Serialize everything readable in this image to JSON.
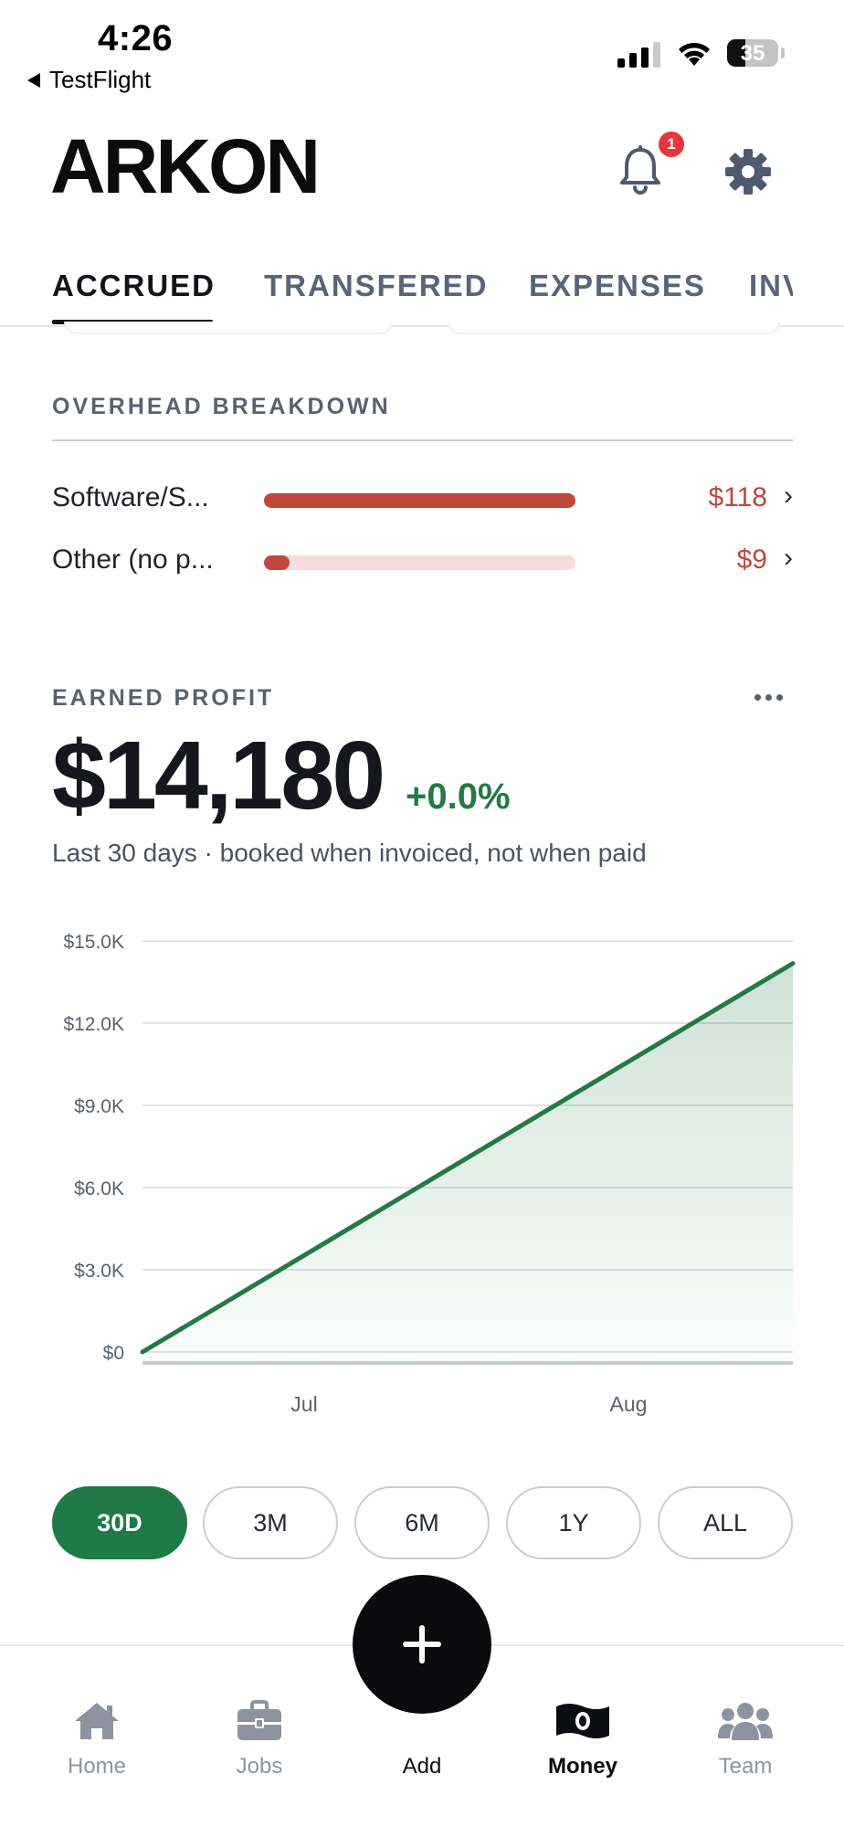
{
  "status_bar": {
    "time": "4:26",
    "back_app": "TestFlight",
    "battery_percent": "35"
  },
  "header": {
    "logo": "ARKON",
    "notification_count": "1",
    "icons": [
      "bell-icon",
      "gear-icon"
    ]
  },
  "tabs": [
    {
      "label": "ACCRUED",
      "active": true
    },
    {
      "label": "TRANSFERED",
      "active": false
    },
    {
      "label": "EXPENSES",
      "active": false
    },
    {
      "label": "INV",
      "active": false
    }
  ],
  "overhead": {
    "title": "OVERHEAD BREAKDOWN",
    "items": [
      {
        "name": "Software/S...",
        "value": "$118",
        "fill_fraction": 1.0
      },
      {
        "name": "Other (no p...",
        "value": "$9",
        "fill_fraction": 0.076
      }
    ]
  },
  "profit": {
    "title": "EARNED PROFIT",
    "amount": "$14,180",
    "change": "+0.0%",
    "subtitle": "Last 30 days · booked when invoiced, not when paid"
  },
  "chart_data": {
    "type": "area",
    "title": "",
    "xlabel": "",
    "ylabel": "",
    "x_tick_labels": [
      "Jul",
      "Aug"
    ],
    "y_tick_labels": [
      "$15.0K",
      "$12.0K",
      "$9.0K",
      "$6.0K",
      "$3.0K",
      "$0"
    ],
    "y_ticks": [
      15000,
      12000,
      9000,
      6000,
      3000,
      0
    ],
    "ylim": [
      0,
      15000
    ],
    "grid": true,
    "series": [
      {
        "values": [
          {
            "x": "start",
            "y": 0
          },
          {
            "x": "end",
            "y": 14180
          }
        ]
      }
    ],
    "colors": {
      "line": "#237a45",
      "fill": "#237a45"
    }
  },
  "ranges": [
    {
      "label": "30D",
      "active": true
    },
    {
      "label": "3M",
      "active": false
    },
    {
      "label": "6M",
      "active": false
    },
    {
      "label": "1Y",
      "active": false
    },
    {
      "label": "ALL",
      "active": false
    }
  ],
  "nav": {
    "home": "Home",
    "jobs": "Jobs",
    "add": "Add",
    "money": "Money",
    "team": "Team",
    "active": "Money"
  },
  "colors": {
    "accent_green": "#1f7a48",
    "overhead_red": "#c0473e",
    "badge_red": "#e5373a"
  }
}
